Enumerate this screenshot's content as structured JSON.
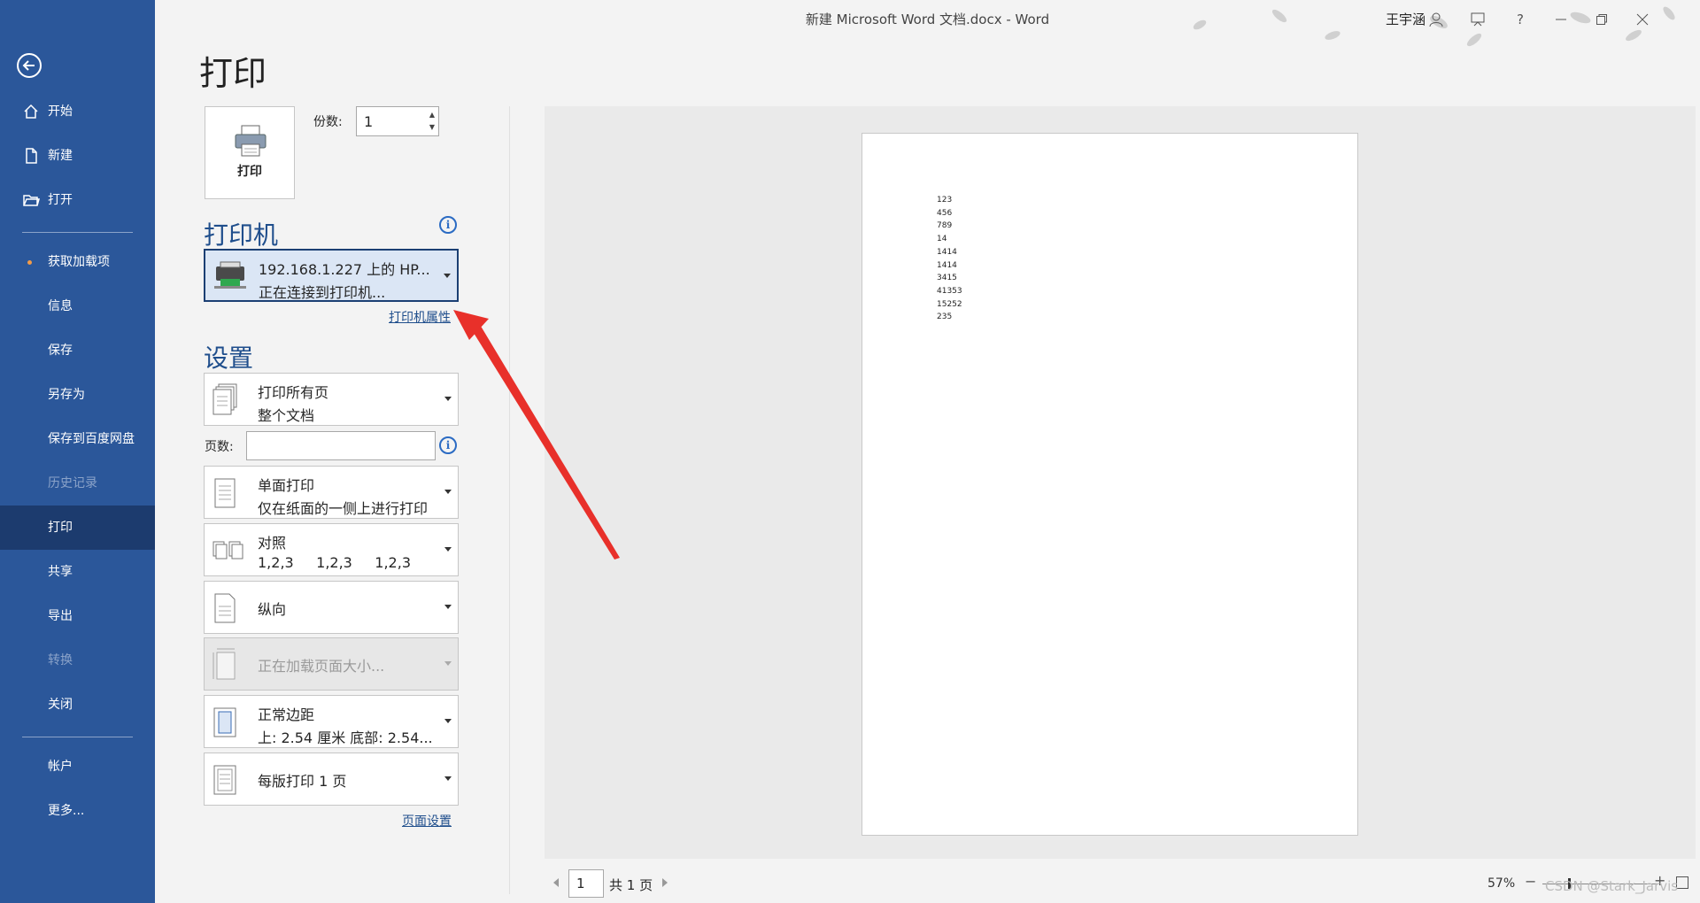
{
  "window": {
    "title": "新建 Microsoft Word 文档.docx  -  Word",
    "user": "王宇涵",
    "controls": [
      "person-icon",
      "share-icon",
      "help-icon",
      "minimize-icon",
      "restore-icon",
      "close-icon"
    ],
    "help_label": "?"
  },
  "sidebar": {
    "accent": "#2b579a",
    "items": [
      {
        "label": "开始",
        "icon": "home-icon"
      },
      {
        "label": "新建",
        "icon": "new-document-icon"
      },
      {
        "label": "打开",
        "icon": "open-folder-icon"
      },
      {
        "label": "获取加载项",
        "icon": "dot"
      },
      {
        "label": "信息"
      },
      {
        "label": "保存"
      },
      {
        "label": "另存为"
      },
      {
        "label": "保存到百度网盘"
      },
      {
        "label": "历史记录",
        "disabled": true
      },
      {
        "label": "打印",
        "active": true
      },
      {
        "label": "共享"
      },
      {
        "label": "导出"
      },
      {
        "label": "转换",
        "disabled": true
      },
      {
        "label": "关闭"
      },
      {
        "label": "帐户"
      },
      {
        "label": "更多..."
      }
    ]
  },
  "print": {
    "heading": "打印",
    "button_label": "打印",
    "copies_label": "份数:",
    "copies_value": "1",
    "printer_section": "打印机",
    "printer_name": "192.168.1.227 上的 HP...",
    "printer_status": "正在连接到打印机...",
    "printer_properties_link": "打印机属性",
    "settings_section": "设置",
    "settings": [
      {
        "line1": "打印所有页",
        "line2": "整个文档",
        "icon": "pages-icon"
      },
      {
        "line1": "单面打印",
        "line2": "仅在纸面的一侧上进行打印",
        "icon": "one-sided-icon"
      },
      {
        "line1": "对照",
        "line2": "1,2,3     1,2,3     1,2,3",
        "icon": "collate-icon"
      },
      {
        "line1": "纵向",
        "icon": "portrait-icon"
      },
      {
        "line1": "正在加载页面大小...",
        "icon": "page-size-icon",
        "disabled": true
      },
      {
        "line1": "正常边距",
        "line2": "上: 2.54 厘米 底部: 2.54...",
        "icon": "margins-icon"
      },
      {
        "line1": "每版打印 1 页",
        "icon": "pages-per-sheet-icon"
      }
    ],
    "pages_label": "页数:",
    "pages_value": "",
    "page_setup_link": "页面设置"
  },
  "preview": {
    "lines": [
      "123",
      "456",
      "789",
      "14",
      "1414",
      "1414",
      "3415",
      "41353",
      "15252",
      "235"
    ],
    "current_page": "1",
    "total_pages": "共 1 页",
    "zoom": "57%",
    "zoom_level_percent": 57,
    "zoom_minus": "−",
    "zoom_plus": "+",
    "watermark": "CSDN @Stark_Jarvis"
  },
  "annotation": {
    "color": "#e8302a"
  }
}
